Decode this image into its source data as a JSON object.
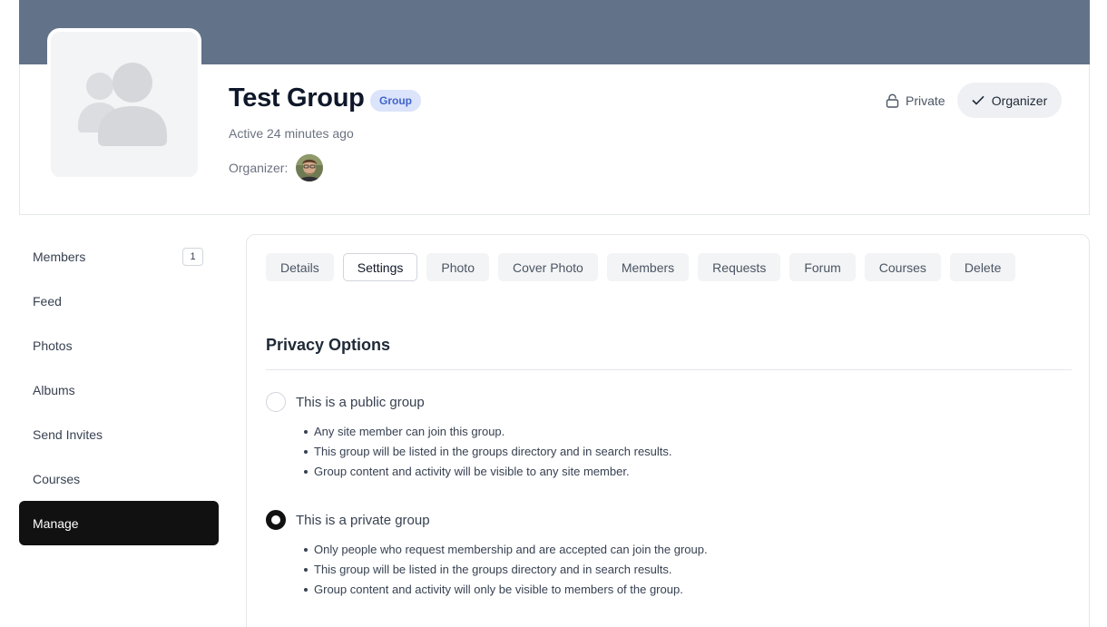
{
  "group": {
    "title": "Test Group",
    "badge": "Group",
    "active": "Active 24 minutes ago",
    "organizer_label": "Organizer:",
    "privacy_status": "Private",
    "organizer_button": "Organizer"
  },
  "sidebar": {
    "items": [
      {
        "label": "Members",
        "count": "1"
      },
      {
        "label": "Feed"
      },
      {
        "label": "Photos"
      },
      {
        "label": "Albums"
      },
      {
        "label": "Send Invites"
      },
      {
        "label": "Courses"
      },
      {
        "label": "Manage",
        "active": true
      }
    ]
  },
  "tabs": [
    {
      "label": "Details"
    },
    {
      "label": "Settings",
      "active": true
    },
    {
      "label": "Photo"
    },
    {
      "label": "Cover Photo"
    },
    {
      "label": "Members"
    },
    {
      "label": "Requests"
    },
    {
      "label": "Forum"
    },
    {
      "label": "Courses"
    },
    {
      "label": "Delete"
    }
  ],
  "privacy": {
    "title": "Privacy Options",
    "options": [
      {
        "label": "This is a public group",
        "checked": false,
        "bullets": [
          "Any site member can join this group.",
          "This group will be listed in the groups directory and in search results.",
          "Group content and activity will be visible to any site member."
        ]
      },
      {
        "label": "This is a private group",
        "checked": true,
        "bullets": [
          "Only people who request membership and are accepted can join the group.",
          "This group will be listed in the groups directory and in search results.",
          "Group content and activity will only be visible to members of the group."
        ]
      }
    ]
  },
  "icons": {
    "lock": "lock-icon",
    "check": "check-icon",
    "group_avatar": "group-avatar-placeholder-icon"
  },
  "colors": {
    "cover": "#627389",
    "badge_bg": "#dbe4fb",
    "badge_text": "#4063c9",
    "active_nav": "#111111"
  }
}
